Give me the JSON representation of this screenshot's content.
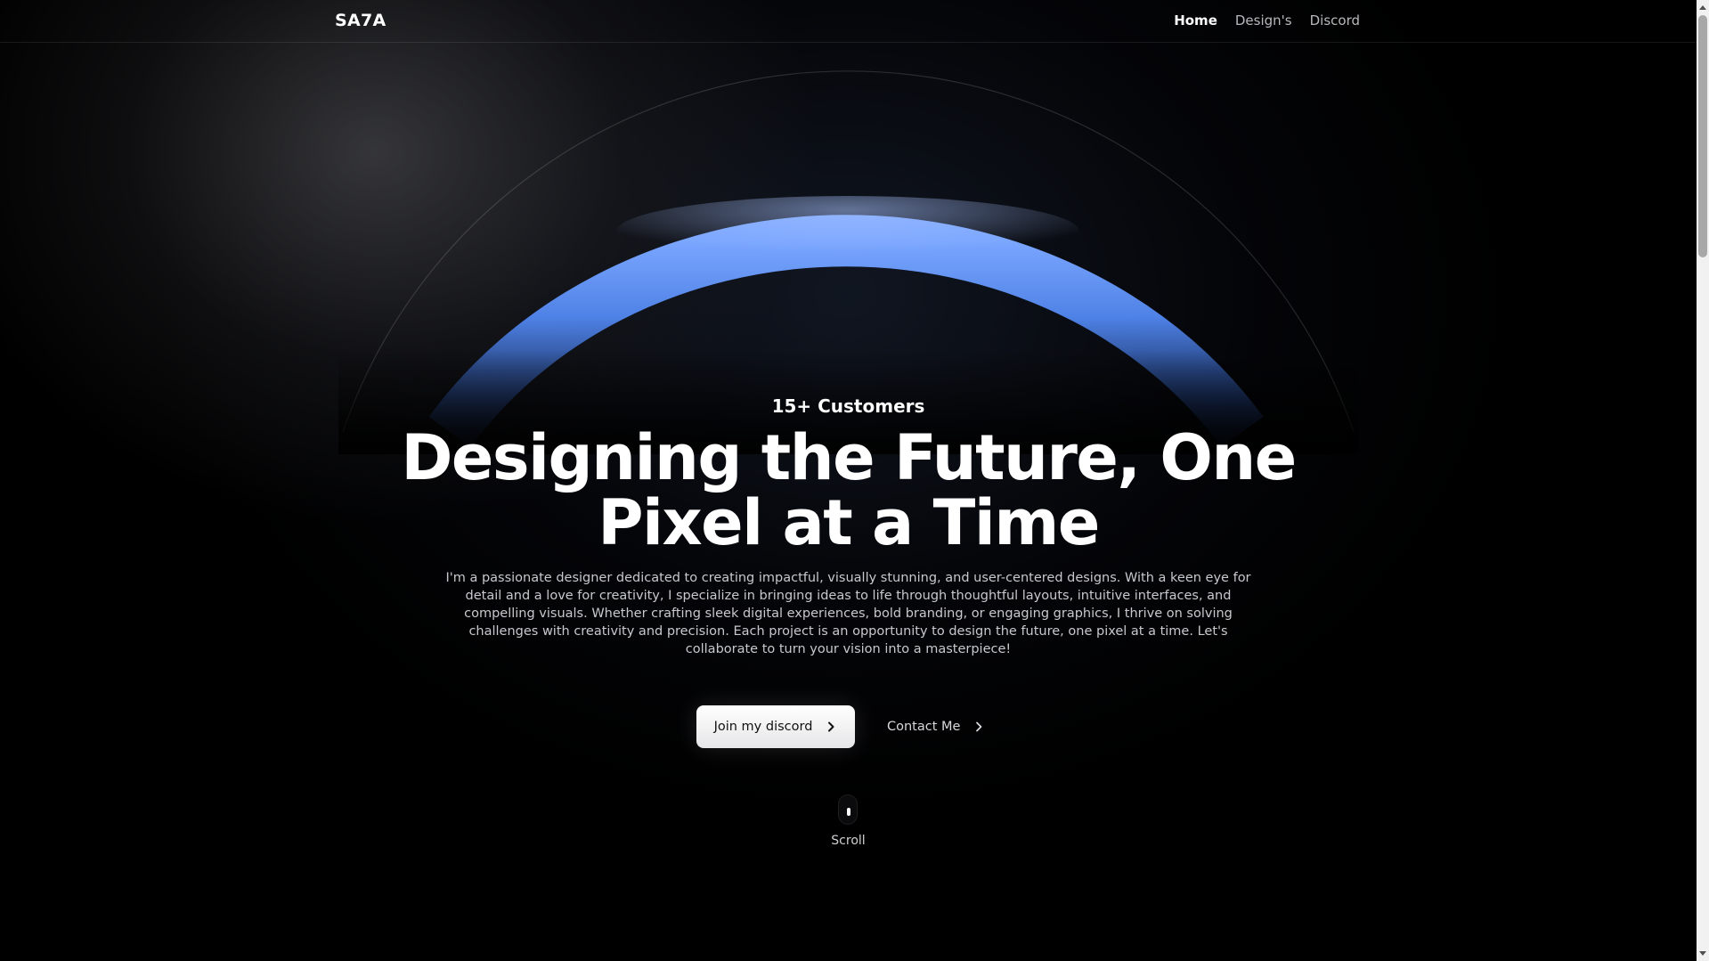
{
  "brand": {
    "name": "SA7A"
  },
  "nav": {
    "items": [
      {
        "label": "Home",
        "active": true
      },
      {
        "label": "Design's",
        "active": false
      },
      {
        "label": "Discord",
        "active": false
      }
    ]
  },
  "hero": {
    "badge": "15+ Customers",
    "headline": "Designing the Future, One Pixel at a Time",
    "description": "I'm a passionate designer dedicated to creating impactful, visually stunning, and user-centered designs. With a keen eye for detail and a love for creativity, I specialize in bringing ideas to life through thoughtful layouts, intuitive interfaces, and compelling visuals. Whether crafting sleek digital experiences, bold branding, or engaging graphics, I thrive on solving challenges with creativity and precision. Each project is an opportunity to design the future, one pixel at a time. Let's collaborate to turn your vision into a masterpiece!",
    "primary_cta": "Join my discord",
    "secondary_cta": "Contact Me",
    "scroll_label": "Scroll"
  },
  "icons": {
    "primary_cta_icon": "chevron-right-icon",
    "secondary_cta_icon": "chevron-right-icon",
    "scroll_icon": "mouse-scroll-icon"
  },
  "colors": {
    "background": "#000000",
    "arc_accent": "#5b8cf0",
    "text_primary": "#ffffff",
    "text_muted": "#c9c9cd",
    "button_bg": "#ffffff"
  }
}
